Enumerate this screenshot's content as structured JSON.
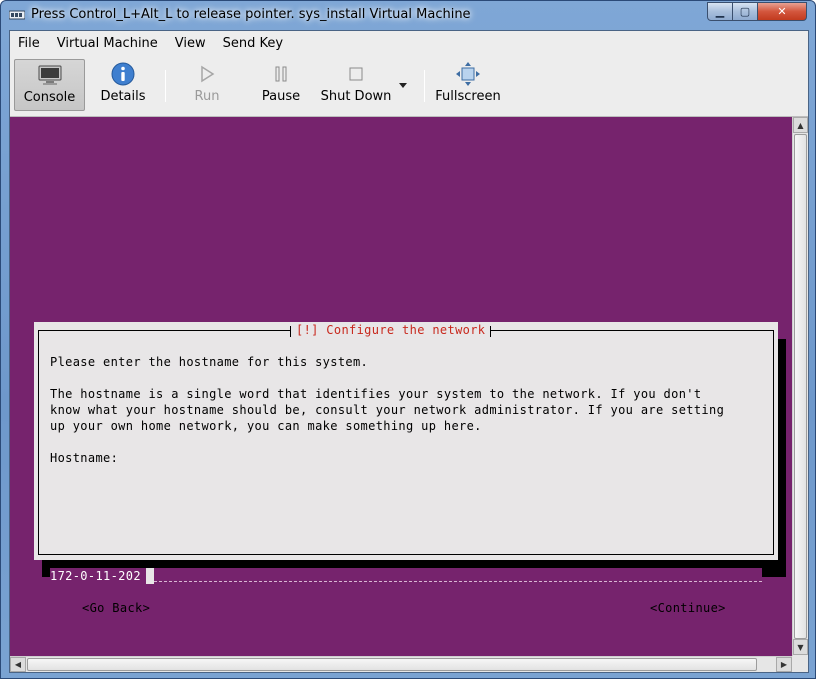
{
  "window": {
    "title": "Press Control_L+Alt_L to release pointer. sys_install Virtual Machine",
    "minimize_glyph": "▁",
    "maximize_glyph": "▢",
    "close_glyph": "✕"
  },
  "menubar": {
    "items": [
      "File",
      "Virtual Machine",
      "View",
      "Send Key"
    ]
  },
  "toolbar": {
    "console": {
      "label": "Console",
      "icon": "monitor-icon",
      "active": true
    },
    "details": {
      "label": "Details",
      "icon": "info-icon"
    },
    "run": {
      "label": "Run",
      "icon": "play-icon",
      "disabled": true
    },
    "pause": {
      "label": "Pause",
      "icon": "pause-icon"
    },
    "shutdown": {
      "label": "Shut Down",
      "icon": "stop-icon",
      "dropdown_icon": "caret-down-icon"
    },
    "fullscreen": {
      "label": "Fullscreen",
      "icon": "fullscreen-icon"
    }
  },
  "installer": {
    "background_color": "#76236d",
    "title": "[!] Configure the network",
    "prompt": "Please enter the hostname for this system.",
    "description_lines": [
      "The hostname is a single word that identifies your system to the network. If you don't",
      "know what your hostname should be, consult your network administrator. If you are setting",
      "up your own home network, you can make something up here."
    ],
    "field_label": "Hostname:",
    "hostname_value": "172-0-11-202",
    "go_back_label": "<Go Back>",
    "continue_label": "<Continue>"
  },
  "colors": {
    "accent_title": "#c8281d",
    "dialog_bg": "#e8e6e7"
  }
}
